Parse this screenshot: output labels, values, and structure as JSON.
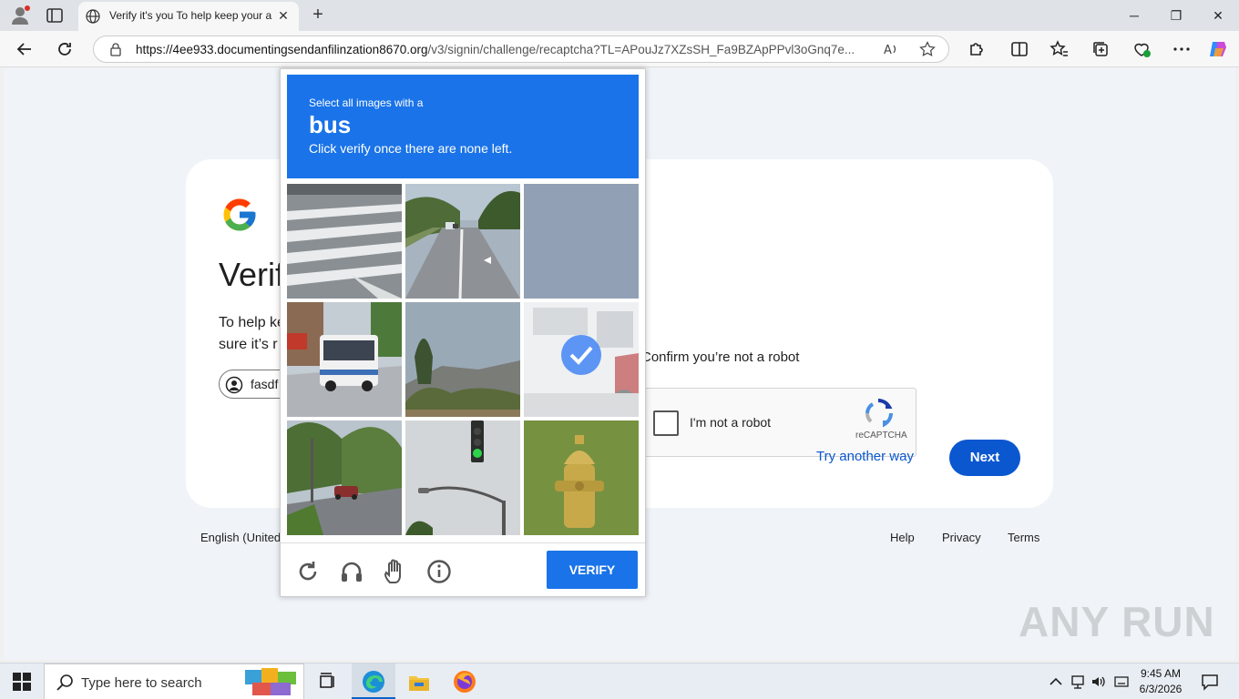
{
  "browser": {
    "tab_title": "Verify it's you To help keep your a",
    "url_host": "https://4ee933.documentingsendanfilinzation8670.org",
    "url_path": "/v3/signin/challenge/recaptcha?TL=APouJz7XZsSH_Fa9BZApPPvl3oGnq7e...",
    "close_glyph": "✕",
    "newtab_glyph": "+",
    "minimize_glyph": "─",
    "restore_glyph": "❐",
    "window_close_glyph": "✕"
  },
  "signin": {
    "title": "Verif",
    "description_line1": "To help ke",
    "description_line2": "sure it’s r",
    "account_chip": "fasdf",
    "confirm_text": "Confirm you’re not a robot",
    "recaptcha_label": "I'm not a robot",
    "recaptcha_brand": "reCAPTCHA",
    "try_another": "Try another way",
    "next": "Next"
  },
  "footer": {
    "language": "English (United",
    "help": "Help",
    "privacy": "Privacy",
    "terms": "Terms"
  },
  "captcha": {
    "instruction": "Select all images with a",
    "target": "bus",
    "subtext": "Click verify once there are none left.",
    "verify": "VERIFY",
    "tiles": [
      {
        "scene": "crosswalk",
        "selected": false
      },
      {
        "scene": "road-with-cars",
        "selected": false
      },
      {
        "scene": "sky",
        "selected": false
      },
      {
        "scene": "bus",
        "selected": false
      },
      {
        "scene": "trees-mountain",
        "selected": false
      },
      {
        "scene": "bus-closeup",
        "selected": true
      },
      {
        "scene": "street-intersection",
        "selected": false
      },
      {
        "scene": "traffic-light",
        "selected": false
      },
      {
        "scene": "fire-hydrant",
        "selected": false
      }
    ]
  },
  "watermark": "ANY RUN",
  "taskbar": {
    "search_placeholder": "Type here to search",
    "time": "9:45 AM",
    "date": "6/3/2026"
  },
  "colors": {
    "captcha_blue": "#1a73e8",
    "google_blue": "#0b57d0"
  }
}
